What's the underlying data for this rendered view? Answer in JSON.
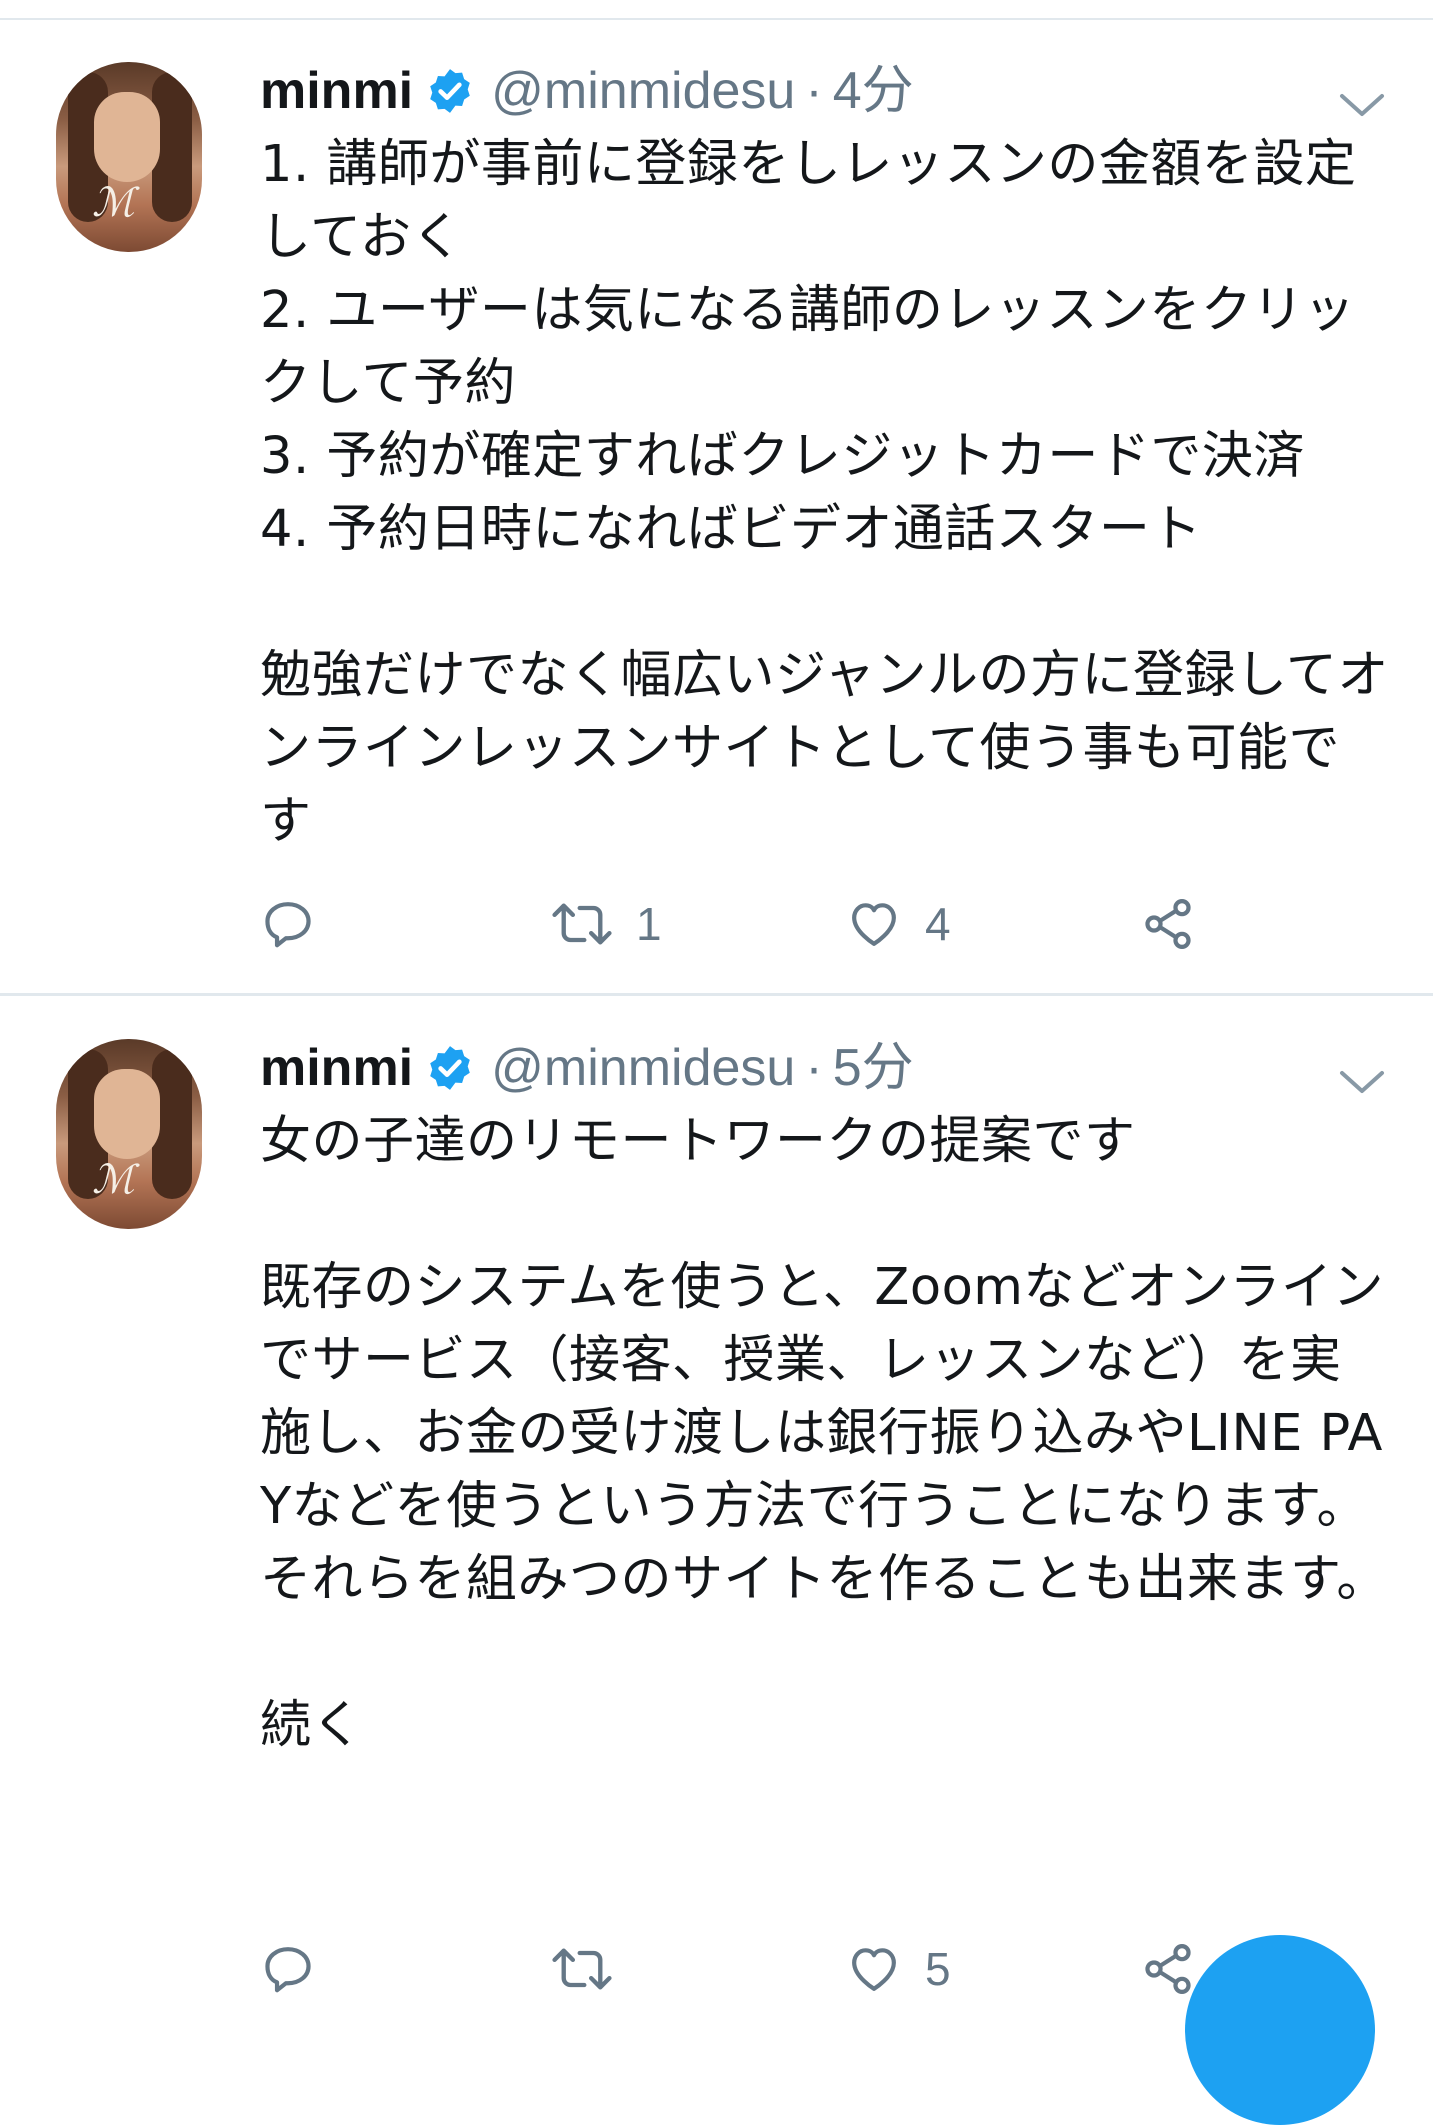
{
  "colors": {
    "accent": "#1da1f2",
    "text_primary": "#14171a",
    "text_secondary": "#657786",
    "divider": "#e1e8ed"
  },
  "tweets": [
    {
      "name": "minmi",
      "handle": "@minmidesu",
      "separator": "·",
      "time": "4分",
      "verified": true,
      "body": "1. 講師が事前に登録をしレッスンの金額を設定しておく\n2. ユーザーは気になる講師のレッスンをクリックして予約\n3. 予約が確定すればクレジットカードで決済\n4. 予約日時になればビデオ通話スタート\n\n勉強だけでなく幅広いジャンルの方に登録してオンラインレッスンサイトとして使う事も可能です",
      "reply_count": "",
      "retweet_count": "1",
      "like_count": "4"
    },
    {
      "name": "minmi",
      "handle": "@minmidesu",
      "separator": "·",
      "time": "5分",
      "verified": true,
      "body": "女の子達のリモートワークの提案です\n\n既存のシステムを使うと、Zoomなどオンラインでサービス（接客、授業、レッスンなど）を実施し、お金の受け渡しは銀行振り込みやLINE PAYなどを使うという方法で行うことになります。\nそれらを組みつのサイトを作ることも出来ます。\n\n続く",
      "reply_count": "",
      "retweet_count": "",
      "like_count": "5"
    }
  ],
  "icons": {
    "verified": "verified-badge-icon",
    "chevron": "chevron-down-icon",
    "reply": "reply-icon",
    "retweet": "retweet-icon",
    "like": "heart-icon",
    "share": "share-icon"
  }
}
